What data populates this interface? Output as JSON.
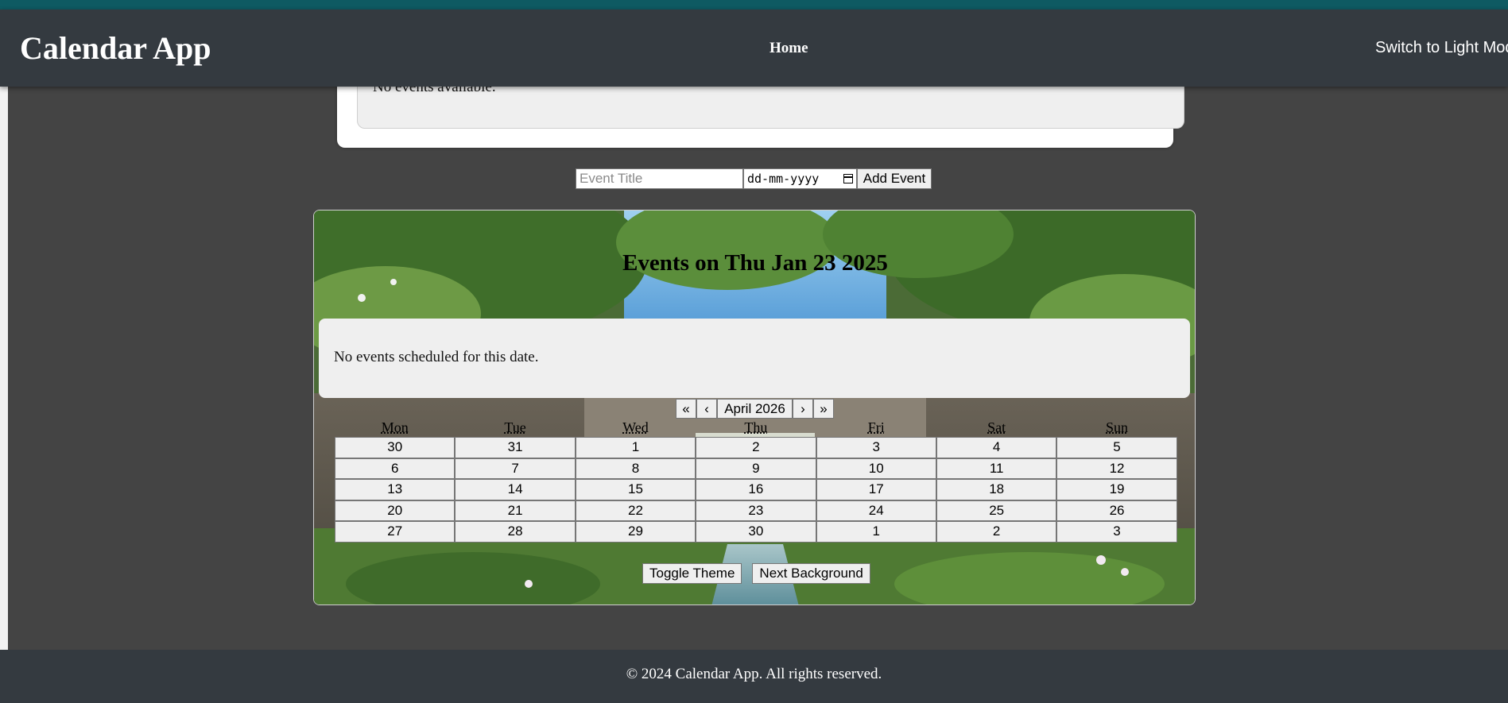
{
  "header": {
    "title": "Calendar App",
    "nav_home": "Home",
    "theme_switch": "Switch to Light Mode"
  },
  "upcoming": {
    "empty_message": "No events available."
  },
  "add_event": {
    "title_placeholder": "Event Title",
    "date_placeholder": "dd-mm-yyyy",
    "add_label": "Add Event"
  },
  "selected_day": {
    "heading": "Events on Thu Jan 23 2025",
    "empty_message": "No events scheduled for this date."
  },
  "calendar": {
    "prev_year": "«",
    "prev_month": "‹",
    "month_label": "April 2026",
    "next_month": "›",
    "next_year": "»",
    "weekdays": [
      "Mon",
      "Tue",
      "Wed",
      "Thu",
      "Fri",
      "Sat",
      "Sun"
    ],
    "weeks": [
      [
        "30",
        "31",
        "1",
        "2",
        "3",
        "4",
        "5"
      ],
      [
        "6",
        "7",
        "8",
        "9",
        "10",
        "11",
        "12"
      ],
      [
        "13",
        "14",
        "15",
        "16",
        "17",
        "18",
        "19"
      ],
      [
        "20",
        "21",
        "22",
        "23",
        "24",
        "25",
        "26"
      ],
      [
        "27",
        "28",
        "29",
        "30",
        "1",
        "2",
        "3"
      ]
    ]
  },
  "controls": {
    "toggle_theme": "Toggle Theme",
    "next_background": "Next Background"
  },
  "footer": {
    "text": "© 2024 Calendar App. All rights reserved."
  }
}
